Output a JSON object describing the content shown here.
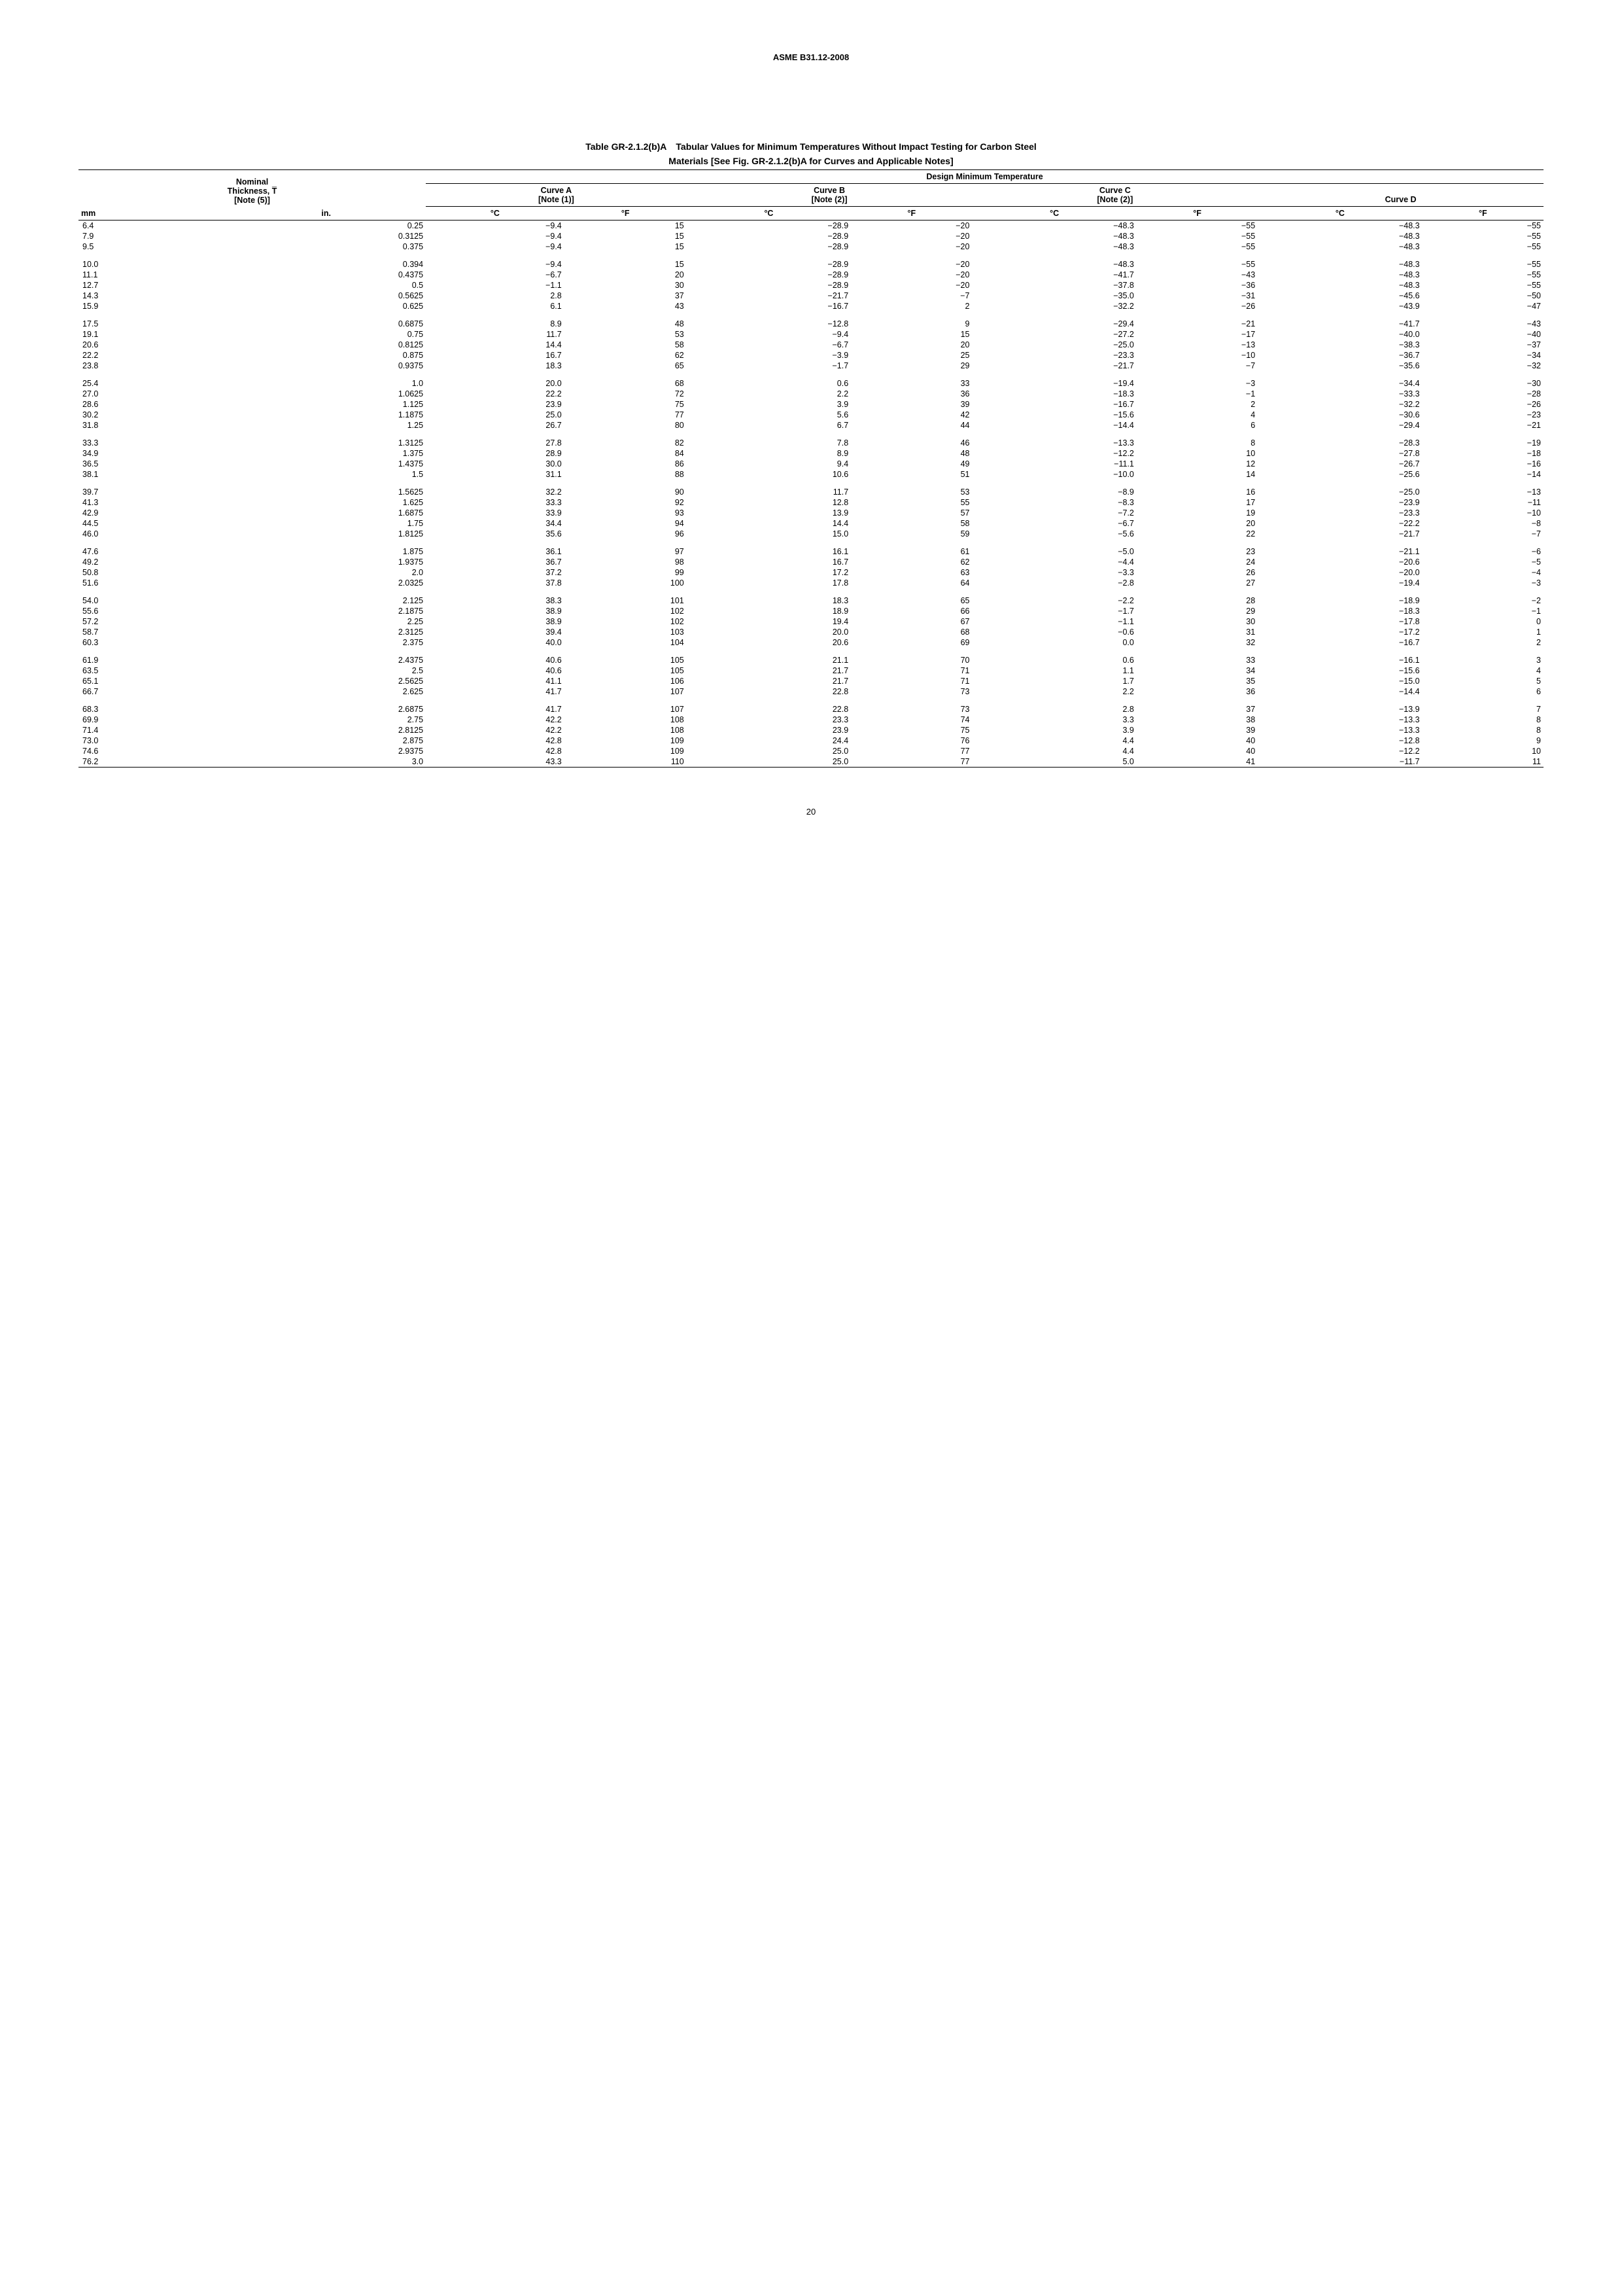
{
  "standard": "ASME B31.12-2008",
  "title_line1": "Table GR-2.1.2(b)A Tabular Values for Minimum Temperatures Without Impact Testing for Carbon Steel",
  "title_line2": "Materials [See Fig. GR-2.1.2(b)A for Curves and Applicable Notes]",
  "header": {
    "nominal": "Nominal",
    "thickness": "Thickness, T̅",
    "note5": "[Note (5)]",
    "design": "Design Minimum Temperature",
    "curveA": "Curve A",
    "note1": "[Note (1)]",
    "curveB": "Curve B",
    "note2": "[Note (2)]",
    "curveC": "Curve C",
    "curveD": "Curve D",
    "mm": "mm",
    "in": "in.",
    "degC": "°C",
    "degF": "°F"
  },
  "rows": [
    [
      "6.4",
      "0.25",
      "−9.4",
      "15",
      "−28.9",
      "−20",
      "−48.3",
      "−55",
      "−48.3",
      "−55"
    ],
    [
      "7.9",
      "0.3125",
      "−9.4",
      "15",
      "−28.9",
      "−20",
      "−48.3",
      "−55",
      "−48.3",
      "−55"
    ],
    [
      "9.5",
      "0.375",
      "−9.4",
      "15",
      "−28.9",
      "−20",
      "−48.3",
      "−55",
      "−48.3",
      "−55"
    ],
    [
      "10.0",
      "0.394",
      "−9.4",
      "15",
      "−28.9",
      "−20",
      "−48.3",
      "−55",
      "−48.3",
      "−55"
    ],
    [
      "11.1",
      "0.4375",
      "−6.7",
      "20",
      "−28.9",
      "−20",
      "−41.7",
      "−43",
      "−48.3",
      "−55"
    ],
    [
      "12.7",
      "0.5",
      "−1.1",
      "30",
      "−28.9",
      "−20",
      "−37.8",
      "−36",
      "−48.3",
      "−55"
    ],
    [
      "14.3",
      "0.5625",
      "2.8",
      "37",
      "−21.7",
      "−7",
      "−35.0",
      "−31",
      "−45.6",
      "−50"
    ],
    [
      "15.9",
      "0.625",
      "6.1",
      "43",
      "−16.7",
      "2",
      "−32.2",
      "−26",
      "−43.9",
      "−47"
    ],
    [
      "17.5",
      "0.6875",
      "8.9",
      "48",
      "−12.8",
      "9",
      "−29.4",
      "−21",
      "−41.7",
      "−43"
    ],
    [
      "19.1",
      "0.75",
      "11.7",
      "53",
      "−9.4",
      "15",
      "−27.2",
      "−17",
      "−40.0",
      "−40"
    ],
    [
      "20.6",
      "0.8125",
      "14.4",
      "58",
      "−6.7",
      "20",
      "−25.0",
      "−13",
      "−38.3",
      "−37"
    ],
    [
      "22.2",
      "0.875",
      "16.7",
      "62",
      "−3.9",
      "25",
      "−23.3",
      "−10",
      "−36.7",
      "−34"
    ],
    [
      "23.8",
      "0.9375",
      "18.3",
      "65",
      "−1.7",
      "29",
      "−21.7",
      "−7",
      "−35.6",
      "−32"
    ],
    [
      "25.4",
      "1.0",
      "20.0",
      "68",
      "0.6",
      "33",
      "−19.4",
      "−3",
      "−34.4",
      "−30"
    ],
    [
      "27.0",
      "1.0625",
      "22.2",
      "72",
      "2.2",
      "36",
      "−18.3",
      "−1",
      "−33.3",
      "−28"
    ],
    [
      "28.6",
      "1.125",
      "23.9",
      "75",
      "3.9",
      "39",
      "−16.7",
      "2",
      "−32.2",
      "−26"
    ],
    [
      "30.2",
      "1.1875",
      "25.0",
      "77",
      "5.6",
      "42",
      "−15.6",
      "4",
      "−30.6",
      "−23"
    ],
    [
      "31.8",
      "1.25",
      "26.7",
      "80",
      "6.7",
      "44",
      "−14.4",
      "6",
      "−29.4",
      "−21"
    ],
    [
      "33.3",
      "1.3125",
      "27.8",
      "82",
      "7.8",
      "46",
      "−13.3",
      "8",
      "−28.3",
      "−19"
    ],
    [
      "34.9",
      "1.375",
      "28.9",
      "84",
      "8.9",
      "48",
      "−12.2",
      "10",
      "−27.8",
      "−18"
    ],
    [
      "36.5",
      "1.4375",
      "30.0",
      "86",
      "9.4",
      "49",
      "−11.1",
      "12",
      "−26.7",
      "−16"
    ],
    [
      "38.1",
      "1.5",
      "31.1",
      "88",
      "10.6",
      "51",
      "−10.0",
      "14",
      "−25.6",
      "−14"
    ],
    [
      "39.7",
      "1.5625",
      "32.2",
      "90",
      "11.7",
      "53",
      "−8.9",
      "16",
      "−25.0",
      "−13"
    ],
    [
      "41.3",
      "1.625",
      "33.3",
      "92",
      "12.8",
      "55",
      "−8.3",
      "17",
      "−23.9",
      "−11"
    ],
    [
      "42.9",
      "1.6875",
      "33.9",
      "93",
      "13.9",
      "57",
      "−7.2",
      "19",
      "−23.3",
      "−10"
    ],
    [
      "44.5",
      "1.75",
      "34.4",
      "94",
      "14.4",
      "58",
      "−6.7",
      "20",
      "−22.2",
      "−8"
    ],
    [
      "46.0",
      "1.8125",
      "35.6",
      "96",
      "15.0",
      "59",
      "−5.6",
      "22",
      "−21.7",
      "−7"
    ],
    [
      "47.6",
      "1.875",
      "36.1",
      "97",
      "16.1",
      "61",
      "−5.0",
      "23",
      "−21.1",
      "−6"
    ],
    [
      "49.2",
      "1.9375",
      "36.7",
      "98",
      "16.7",
      "62",
      "−4.4",
      "24",
      "−20.6",
      "−5"
    ],
    [
      "50.8",
      "2.0",
      "37.2",
      "99",
      "17.2",
      "63",
      "−3.3",
      "26",
      "−20.0",
      "−4"
    ],
    [
      "51.6",
      "2.0325",
      "37.8",
      "100",
      "17.8",
      "64",
      "−2.8",
      "27",
      "−19.4",
      "−3"
    ],
    [
      "54.0",
      "2.125",
      "38.3",
      "101",
      "18.3",
      "65",
      "−2.2",
      "28",
      "−18.9",
      "−2"
    ],
    [
      "55.6",
      "2.1875",
      "38.9",
      "102",
      "18.9",
      "66",
      "−1.7",
      "29",
      "−18.3",
      "−1"
    ],
    [
      "57.2",
      "2.25",
      "38.9",
      "102",
      "19.4",
      "67",
      "−1.1",
      "30",
      "−17.8",
      "0"
    ],
    [
      "58.7",
      "2.3125",
      "39.4",
      "103",
      "20.0",
      "68",
      "−0.6",
      "31",
      "−17.2",
      "1"
    ],
    [
      "60.3",
      "2.375",
      "40.0",
      "104",
      "20.6",
      "69",
      "0.0",
      "32",
      "−16.7",
      "2"
    ],
    [
      "61.9",
      "2.4375",
      "40.6",
      "105",
      "21.1",
      "70",
      "0.6",
      "33",
      "−16.1",
      "3"
    ],
    [
      "63.5",
      "2.5",
      "40.6",
      "105",
      "21.7",
      "71",
      "1.1",
      "34",
      "−15.6",
      "4"
    ],
    [
      "65.1",
      "2.5625",
      "41.1",
      "106",
      "21.7",
      "71",
      "1.7",
      "35",
      "−15.0",
      "5"
    ],
    [
      "66.7",
      "2.625",
      "41.7",
      "107",
      "22.8",
      "73",
      "2.2",
      "36",
      "−14.4",
      "6"
    ],
    [
      "68.3",
      "2.6875",
      "41.7",
      "107",
      "22.8",
      "73",
      "2.8",
      "37",
      "−13.9",
      "7"
    ],
    [
      "69.9",
      "2.75",
      "42.2",
      "108",
      "23.3",
      "74",
      "3.3",
      "38",
      "−13.3",
      "8"
    ],
    [
      "71.4",
      "2.8125",
      "42.2",
      "108",
      "23.9",
      "75",
      "3.9",
      "39",
      "−13.3",
      "8"
    ],
    [
      "73.0",
      "2.875",
      "42.8",
      "109",
      "24.4",
      "76",
      "4.4",
      "40",
      "−12.8",
      "9"
    ],
    [
      "74.6",
      "2.9375",
      "42.8",
      "109",
      "25.0",
      "77",
      "4.4",
      "40",
      "−12.2",
      "10"
    ],
    [
      "76.2",
      "3.0",
      "43.3",
      "110",
      "25.0",
      "77",
      "5.0",
      "41",
      "−11.7",
      "11"
    ]
  ],
  "groupBreaks": [
    3,
    8,
    13,
    18,
    22,
    27,
    31,
    36,
    40
  ],
  "pageNumber": "20",
  "chart_data": {
    "type": "table",
    "title": "Tabular Values for Minimum Temperatures Without Impact Testing for Carbon Steel Materials",
    "columns": [
      "Nominal Thickness mm",
      "Nominal Thickness in.",
      "Curve A °C",
      "Curve A °F",
      "Curve B °C",
      "Curve B °F",
      "Curve C °C",
      "Curve C °F",
      "Curve D °C",
      "Curve D °F"
    ]
  }
}
